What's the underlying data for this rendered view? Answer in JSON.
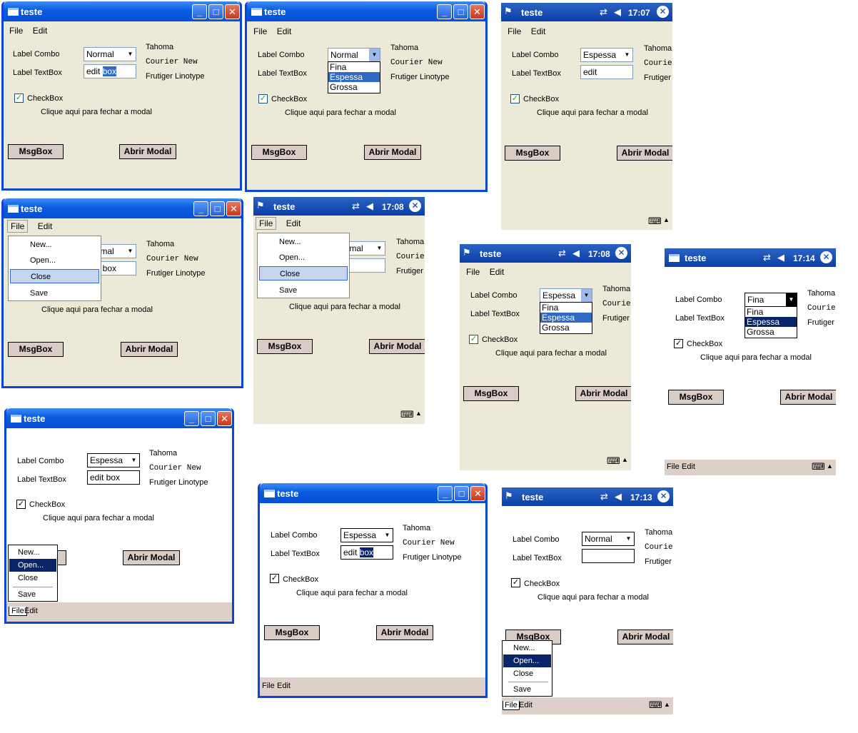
{
  "window": {
    "title": "teste",
    "minimize": "_",
    "maximize": "□",
    "close": "✕"
  },
  "menu": {
    "file": "File",
    "edit": "Edit",
    "items": [
      "New...",
      "Open...",
      "Close",
      "Save"
    ]
  },
  "form": {
    "label_combo": "Label Combo",
    "label_textbox": "Label TextBox",
    "checkbox_label": "CheckBox",
    "checkbox_checked": true,
    "close_modal_text": "Clique aqui para fechar a modal",
    "font_tahoma": "Tahoma",
    "font_courier": "Courier New",
    "font_frutiger": "Frutiger Linotype",
    "btn_msgbox": "MsgBox",
    "btn_abrir": "Abrir Modal",
    "textbox_part1": "edit",
    "textbox_part2": "box",
    "textbox_full": "edit box",
    "combo_options": [
      "Fina",
      "Espessa",
      "Grossa"
    ],
    "combo_normal": "Normal",
    "combo_espessa": "Espessa"
  },
  "pocketpc": {
    "times": [
      "17:07",
      "17:08",
      "17:08",
      "17:14",
      "17:13"
    ]
  },
  "icons": [
    "window-icon",
    "windows-flag-icon",
    "signal-icon",
    "speaker-icon",
    "close-circle-icon",
    "keyboard-icon",
    "arrow-up-icon",
    "checkmark-icon",
    "chevron-down-icon"
  ]
}
